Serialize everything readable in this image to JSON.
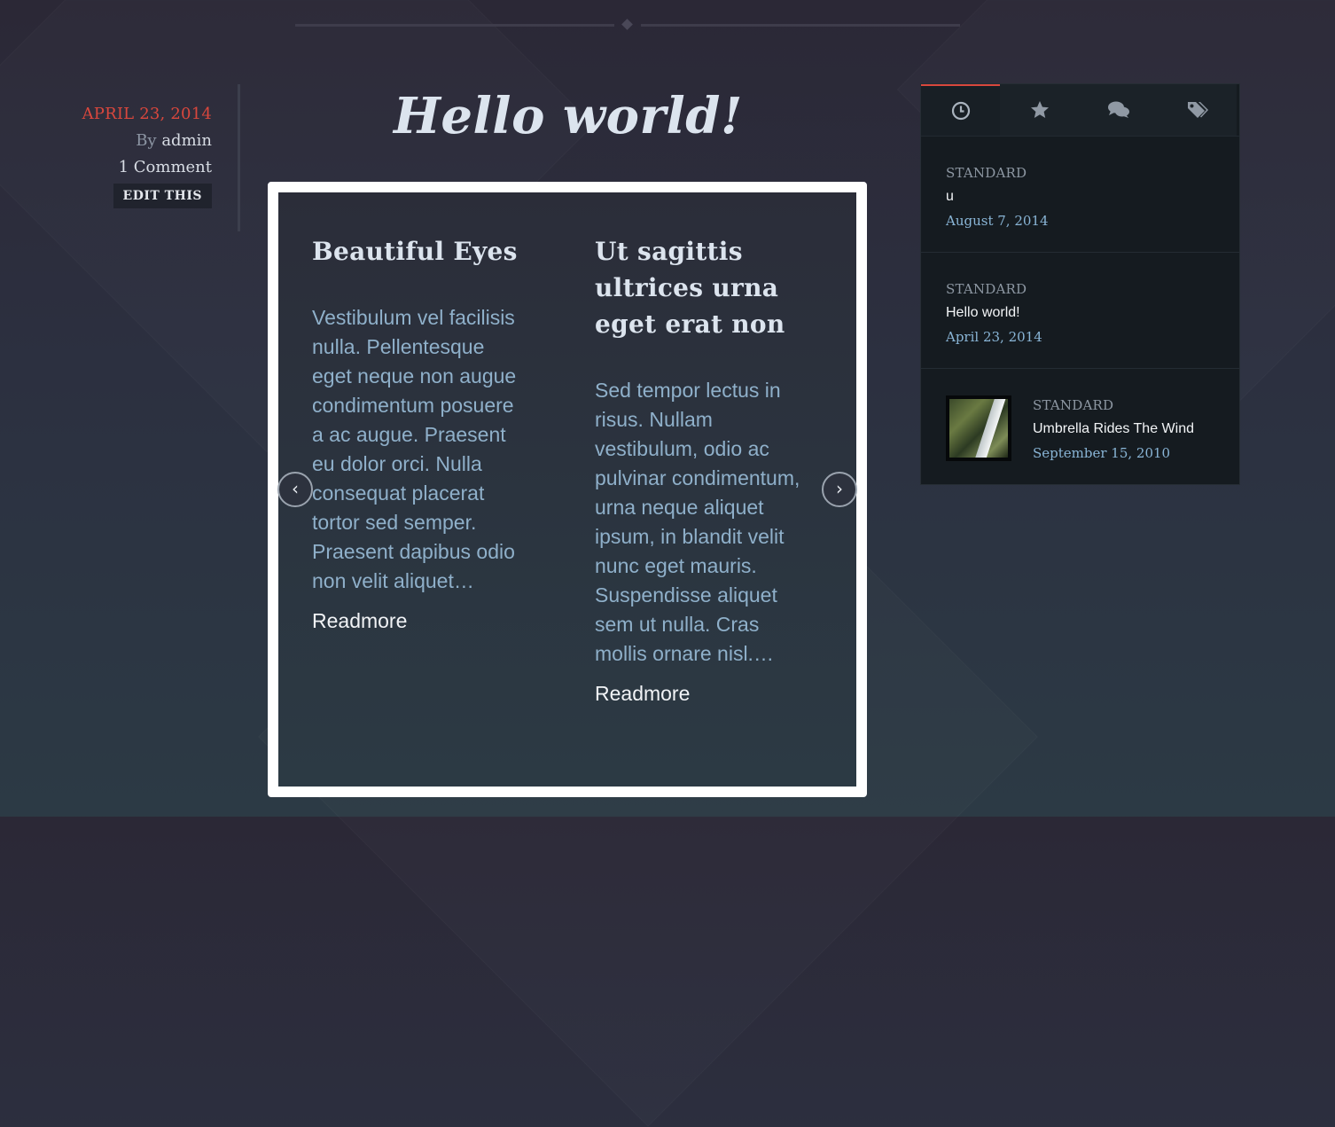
{
  "post": {
    "date": "APRIL 23, 2014",
    "by_label": "By",
    "author": "admin",
    "comments": "1 Comment",
    "edit_label": "EDIT THIS",
    "title": "Hello world!"
  },
  "carousel": {
    "prev_glyph": "‹",
    "next_glyph": "›",
    "slides": [
      {
        "title": "Beautiful Eyes",
        "excerpt": "Vestibulum vel facilisis nulla. Pellentesque eget neque non augue condimentum posuere a ac augue. Praesent eu dolor orci. Nulla consequat placerat tortor sed semper. Praesent dapibus odio non velit aliquet…",
        "readmore": "Readmore"
      },
      {
        "title": "Ut sagittis ultrices urna eget erat non",
        "excerpt": "Sed tempor lectus in risus. Nullam vestibulum, odio ac pulvinar condimentum, urna neque aliquet ipsum, in blandit velit nunc eget mauris. Suspendisse aliquet sem ut nulla. Cras mollis ornare nisl.…",
        "readmore": "Readmore"
      }
    ]
  },
  "widget": {
    "tabs": [
      {
        "icon": "clock-icon",
        "active": true
      },
      {
        "icon": "star-icon",
        "active": false
      },
      {
        "icon": "comments-icon",
        "active": false
      },
      {
        "icon": "tags-icon",
        "active": false
      }
    ],
    "items": [
      {
        "category": "STANDARD",
        "title": "u",
        "date": "August 7, 2014"
      },
      {
        "category": "STANDARD",
        "title": "Hello world!",
        "date": "April 23, 2014"
      },
      {
        "category": "STANDARD",
        "title": "Umbrella Rides The Wind",
        "date": "September 15, 2010",
        "has_thumbnail": true
      }
    ]
  },
  "colors": {
    "accent": "#d9473d",
    "link_blue": "#89b5d6",
    "excerpt": "#8fb0ca"
  }
}
